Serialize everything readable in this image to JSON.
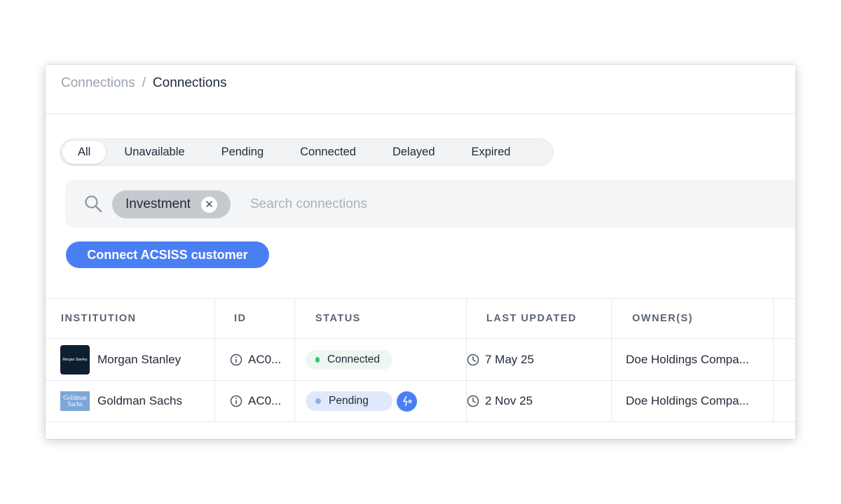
{
  "breadcrumb": {
    "parent": "Connections",
    "separator": "/",
    "current": "Connections"
  },
  "tabs": [
    {
      "label": "All",
      "active": true
    },
    {
      "label": "Unavailable",
      "active": false
    },
    {
      "label": "Pending",
      "active": false
    },
    {
      "label": "Connected",
      "active": false
    },
    {
      "label": "Delayed",
      "active": false
    },
    {
      "label": "Expired",
      "active": false
    }
  ],
  "search": {
    "icon": "search-icon",
    "filter_chip": "Investment",
    "chip_close": "✕",
    "placeholder": "Search connections",
    "value": ""
  },
  "actions": {
    "connect_label": "Connect ACSISS customer"
  },
  "table": {
    "headers": {
      "institution": "INSTITUTION",
      "id": "ID",
      "status": "STATUS",
      "last_updated": "LAST UPDATED",
      "owners": "OWNER(S)"
    },
    "rows": [
      {
        "institution": "Morgan Stanley",
        "logo_text": "Morgan Stanley",
        "id": "AC0...",
        "status": "Connected",
        "status_color": "#2ec46e",
        "last_updated": "7 May 25",
        "owners": "Doe Holdings Compa..."
      },
      {
        "institution": "Goldman Sachs",
        "logo_text": "Goldman Sachs",
        "id": "AC0...",
        "status": "Pending",
        "status_color": "#8fb0ec",
        "last_updated": "2 Nov 25",
        "owners": "Doe Holdings Compa..."
      }
    ]
  },
  "colors": {
    "accent": "#4a7ff4",
    "connected": "#2ec46e",
    "pending_bg": "#dfe9fb"
  }
}
